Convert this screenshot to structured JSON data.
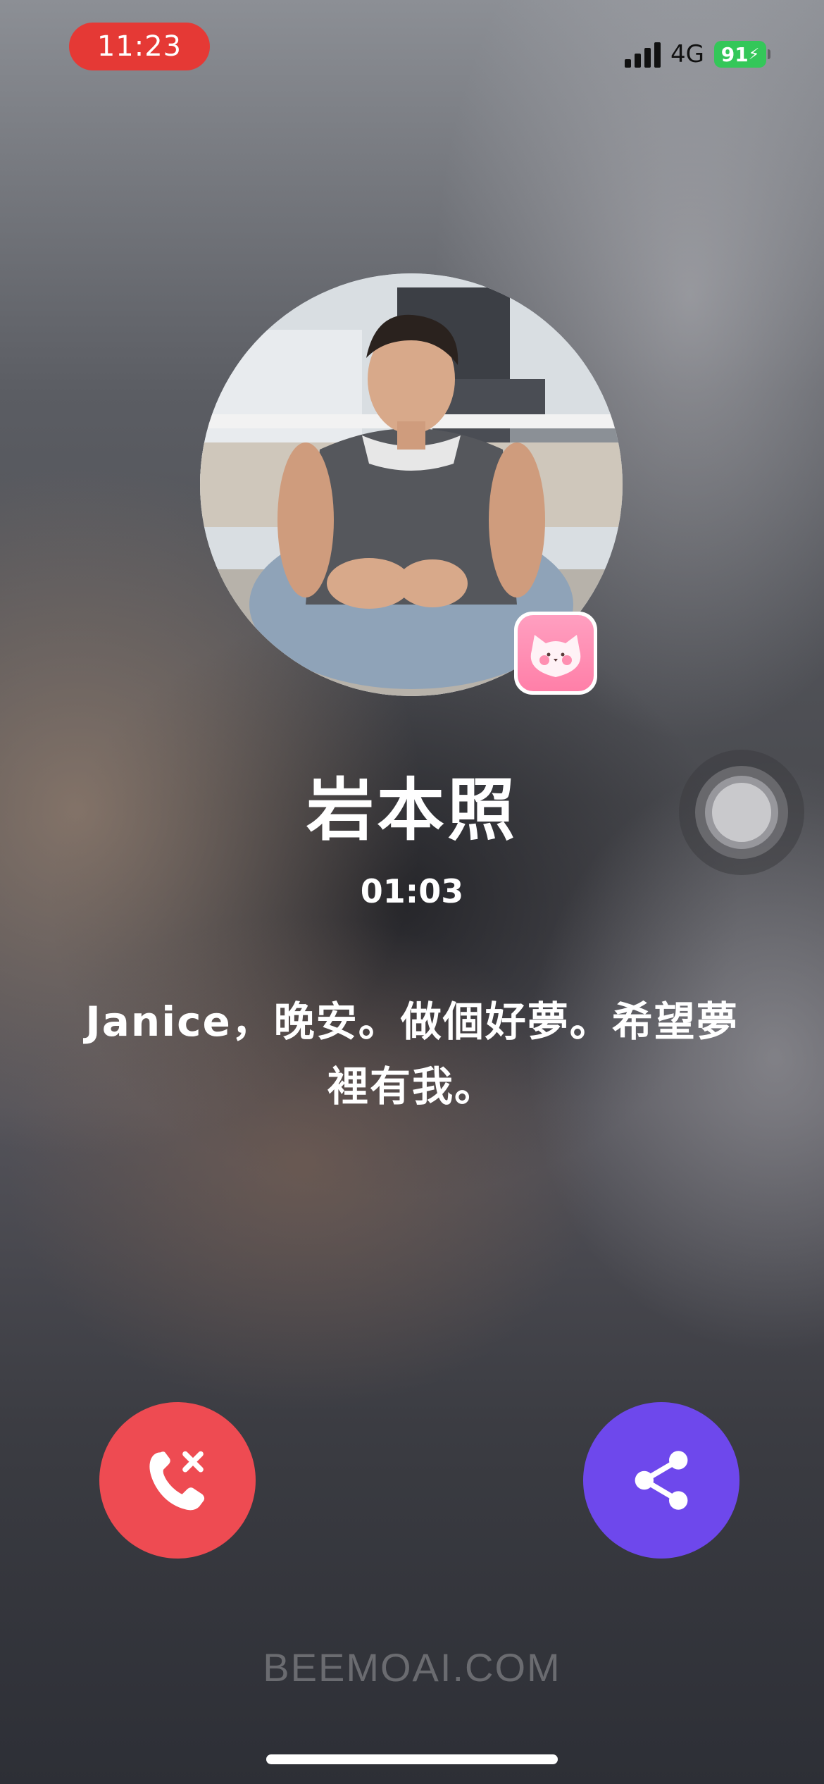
{
  "status_bar": {
    "time": "11:23",
    "network": "4G",
    "battery": "91"
  },
  "caller": {
    "name": "岩本照",
    "duration": "01:03",
    "message": "Janice，晚安。做個好夢。希望夢裡有我。"
  },
  "actions": {
    "end_call_icon": "phone-hangup-icon",
    "share_icon": "share-icon"
  },
  "watermark": "BEEMOAI.COM",
  "colors": {
    "time_pill": "#e53935",
    "end_call": "#ee4b52",
    "share": "#6e48ec",
    "battery": "#34c759"
  }
}
